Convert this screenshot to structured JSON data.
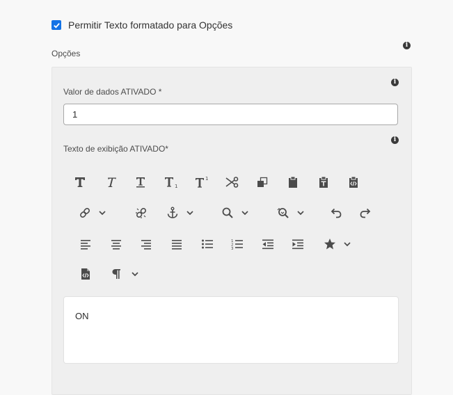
{
  "rich_text_option": {
    "label": "Permitir Texto formatado para Opções",
    "checked": true
  },
  "options_section": {
    "label": "Opções"
  },
  "data_value_field": {
    "label": "Valor de dados ATIVADO *",
    "value": "1"
  },
  "display_text_field": {
    "label": "Texto de exibição ATIVADO*"
  },
  "editor": {
    "content": "ON"
  },
  "info_icon_glyph": "i",
  "toolbar_icons": [
    "bold-icon",
    "italic-icon",
    "underline-icon",
    "subscript-icon",
    "superscript-icon",
    "cut-icon",
    "copy-icon",
    "paste-icon",
    "paste-plain-text-icon",
    "paste-from-word-icon",
    "link-icon",
    "unlink-icon",
    "anchor-icon",
    "find-icon",
    "find-replace-icon",
    "undo-icon",
    "redo-icon",
    "align-left-icon",
    "align-center-icon",
    "align-right-icon",
    "align-justify-icon",
    "bulleted-list-icon",
    "numbered-list-icon",
    "outdent-icon",
    "indent-icon",
    "special-character-icon",
    "source-code-icon",
    "paragraph-format-icon"
  ],
  "colors": {
    "accent": "#1473e6",
    "panel_bg": "#efefef",
    "page_bg": "#f8f8f8"
  }
}
